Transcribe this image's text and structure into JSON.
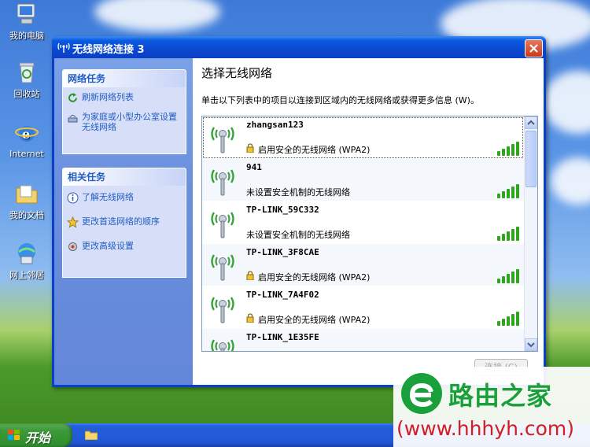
{
  "desktop": {
    "icons": [
      {
        "label": "我的电脑",
        "icon": "my-computer-icon"
      },
      {
        "label": "回收站",
        "icon": "recycle-bin-icon"
      },
      {
        "label": "Internet",
        "icon": "internet-explorer-icon"
      },
      {
        "label": "我的文档",
        "icon": "my-documents-icon"
      },
      {
        "label": "网上邻居",
        "icon": "network-places-icon"
      }
    ]
  },
  "window": {
    "title": "无线网络连接 3",
    "icon": "wireless-icon"
  },
  "taskpane": {
    "network_tasks": {
      "header": "网络任务",
      "items": [
        {
          "label": "刷新网络列表",
          "icon": "refresh-icon"
        },
        {
          "label": "为家庭或小型办公室设置无线网络",
          "icon": "setup-wizard-icon"
        }
      ]
    },
    "related_tasks": {
      "header": "相关任务",
      "items": [
        {
          "label": "了解无线网络",
          "icon": "info-icon"
        },
        {
          "label": "更改首选网络的顺序",
          "icon": "star-icon"
        },
        {
          "label": "更改高级设置",
          "icon": "settings-icon"
        }
      ]
    }
  },
  "main": {
    "title": "选择无线网络",
    "description": "单击以下列表中的项目以连接到区域内的无线网络或获得更多信息 (W)。",
    "connect_label": "连接 (C)"
  },
  "networks": [
    {
      "ssid": "zhangsan123",
      "security": "启用安全的无线网络  (WPA2)",
      "secured": true,
      "signal_bars": 5,
      "selected": true
    },
    {
      "ssid": "941",
      "security": "未设置安全机制的无线网络",
      "secured": false,
      "signal_bars": 5,
      "selected": false
    },
    {
      "ssid": "TP-LINK_59C332",
      "security": "未设置安全机制的无线网络",
      "secured": false,
      "signal_bars": 5,
      "selected": false
    },
    {
      "ssid": "TP-LINK_3F8CAE",
      "security": "启用安全的无线网络  (WPA2)",
      "secured": true,
      "signal_bars": 5,
      "selected": false
    },
    {
      "ssid": "TP-LINK_7A4F02",
      "security": "启用安全的无线网络  (WPA2)",
      "secured": true,
      "signal_bars": 5,
      "selected": false
    },
    {
      "ssid": "TP-LINK_1E35FE",
      "security": "",
      "secured": false,
      "signal_bars": 5,
      "selected": false
    }
  ],
  "taskbar": {
    "start_label": "开始"
  },
  "watermark": {
    "brand": "路由之家",
    "url": "(www.hhhyh.com)"
  },
  "colors": {
    "titlebar": "#0a48d0",
    "link": "#215dc6",
    "signal_green": "#2fa51e",
    "start_green": "#3c9a3a",
    "watermark_green": "#19a03a",
    "watermark_red": "#d21e1e"
  }
}
